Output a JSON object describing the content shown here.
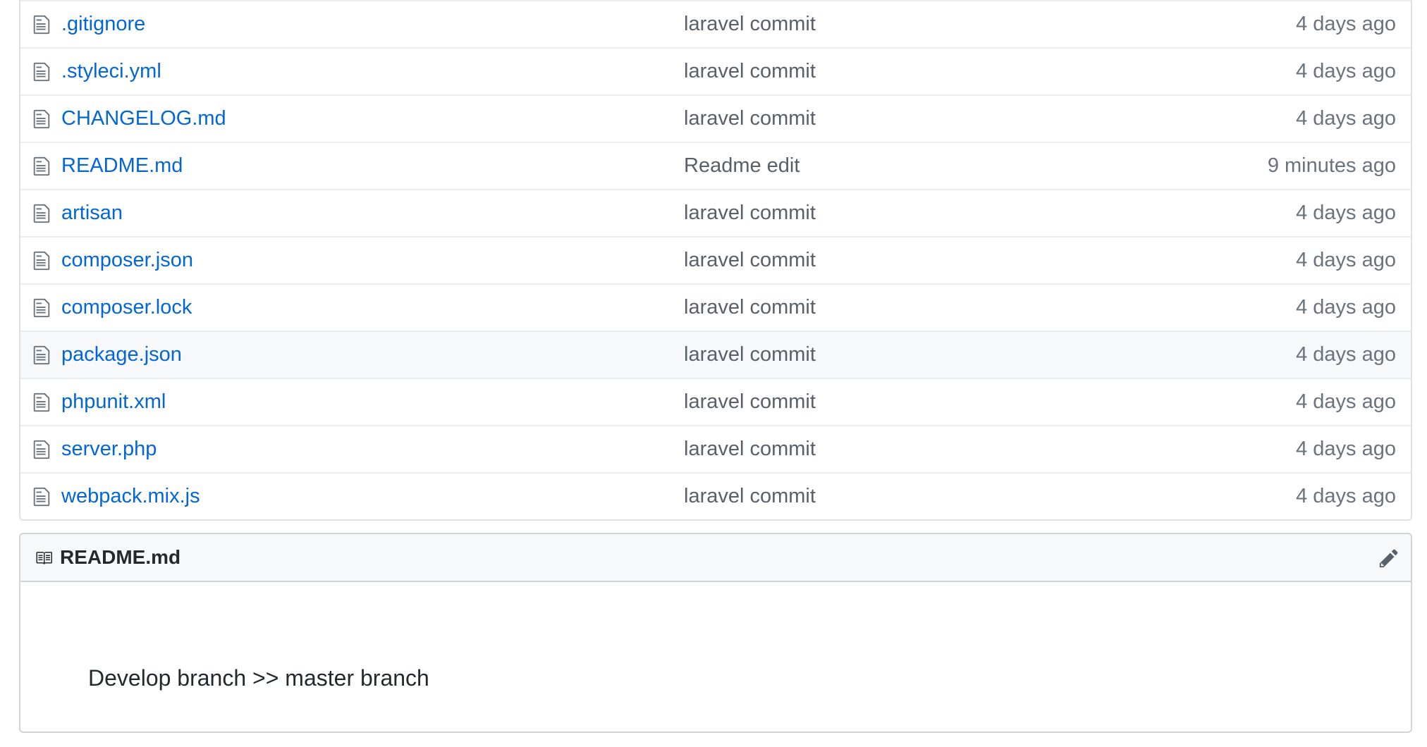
{
  "files": [
    {
      "name": ".gitignore",
      "message": "laravel commit",
      "age": "4 days ago"
    },
    {
      "name": ".styleci.yml",
      "message": "laravel commit",
      "age": "4 days ago"
    },
    {
      "name": "CHANGELOG.md",
      "message": "laravel commit",
      "age": "4 days ago"
    },
    {
      "name": "README.md",
      "message": "Readme edit",
      "age": "9 minutes ago"
    },
    {
      "name": "artisan",
      "message": "laravel commit",
      "age": "4 days ago"
    },
    {
      "name": "composer.json",
      "message": "laravel commit",
      "age": "4 days ago"
    },
    {
      "name": "composer.lock",
      "message": "laravel commit",
      "age": "4 days ago"
    },
    {
      "name": "package.json",
      "message": "laravel commit",
      "age": "4 days ago"
    },
    {
      "name": "phpunit.xml",
      "message": "laravel commit",
      "age": "4 days ago"
    },
    {
      "name": "server.php",
      "message": "laravel commit",
      "age": "4 days ago"
    },
    {
      "name": "webpack.mix.js",
      "message": "laravel commit",
      "age": "4 days ago"
    }
  ],
  "hovered_row_name": "package.json",
  "readme": {
    "title": "README.md",
    "content": "Develop branch >> master branch",
    "edit_icon": "pencil-icon",
    "header_icon": "book-icon"
  },
  "icons": {
    "file": "file-text-icon"
  },
  "colors": {
    "link": "#0366d6",
    "muted": "#586069",
    "border": "#dfe2e5",
    "header_bg": "#f6f8fa"
  }
}
